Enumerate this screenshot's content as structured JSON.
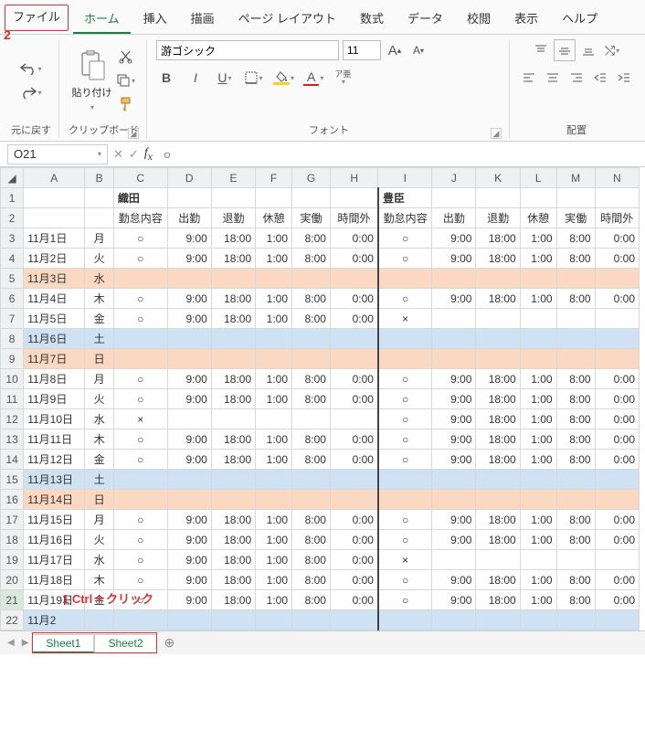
{
  "menu": {
    "items": [
      "ファイル",
      "ホーム",
      "挿入",
      "描画",
      "ページ レイアウト",
      "数式",
      "データ",
      "校閲",
      "表示",
      "ヘルプ"
    ],
    "active": 1,
    "file_highlighted": 0
  },
  "callouts": {
    "file": "2",
    "tabs": "1 Ctrl + クリック"
  },
  "ribbon": {
    "undo": {
      "label": "元に戻す"
    },
    "clipboard": {
      "label": "クリップボード",
      "paste": "貼り付け"
    },
    "font": {
      "label": "フォント",
      "family": "游ゴシック",
      "size": "11",
      "ruby": "ア亜"
    },
    "align": {
      "label": "配置"
    }
  },
  "namebox": "O21",
  "formula": "○",
  "columns": [
    "A",
    "B",
    "C",
    "D",
    "E",
    "F",
    "G",
    "H",
    "I",
    "J",
    "K",
    "L",
    "M",
    "N"
  ],
  "header1": {
    "left_name": "織田",
    "right_name": "豊臣"
  },
  "header2": [
    "勤怠内容",
    "出勤",
    "退勤",
    "休憩",
    "実働",
    "時間外",
    "勤怠内容",
    "出勤",
    "退勤",
    "休憩",
    "実働",
    "時間外"
  ],
  "rows": [
    {
      "n": 3,
      "date": "11月1日",
      "dow": "月",
      "l": [
        "○",
        "9:00",
        "18:00",
        "1:00",
        "8:00",
        "0:00"
      ],
      "r": [
        "○",
        "9:00",
        "18:00",
        "1:00",
        "8:00",
        "0:00"
      ]
    },
    {
      "n": 4,
      "date": "11月2日",
      "dow": "火",
      "l": [
        "○",
        "9:00",
        "18:00",
        "1:00",
        "8:00",
        "0:00"
      ],
      "r": [
        "○",
        "9:00",
        "18:00",
        "1:00",
        "8:00",
        "0:00"
      ]
    },
    {
      "n": 5,
      "date": "11月3日",
      "dow": "水",
      "style": "orange"
    },
    {
      "n": 6,
      "date": "11月4日",
      "dow": "木",
      "l": [
        "○",
        "9:00",
        "18:00",
        "1:00",
        "8:00",
        "0:00"
      ],
      "r": [
        "○",
        "9:00",
        "18:00",
        "1:00",
        "8:00",
        "0:00"
      ]
    },
    {
      "n": 7,
      "date": "11月5日",
      "dow": "金",
      "l": [
        "○",
        "9:00",
        "18:00",
        "1:00",
        "8:00",
        "0:00"
      ],
      "r": [
        "×",
        "",
        "",
        "",
        "",
        ""
      ]
    },
    {
      "n": 8,
      "date": "11月6日",
      "dow": "土",
      "style": "blue"
    },
    {
      "n": 9,
      "date": "11月7日",
      "dow": "日",
      "style": "orange"
    },
    {
      "n": 10,
      "date": "11月8日",
      "dow": "月",
      "l": [
        "○",
        "9:00",
        "18:00",
        "1:00",
        "8:00",
        "0:00"
      ],
      "r": [
        "○",
        "9:00",
        "18:00",
        "1:00",
        "8:00",
        "0:00"
      ]
    },
    {
      "n": 11,
      "date": "11月9日",
      "dow": "火",
      "l": [
        "○",
        "9:00",
        "18:00",
        "1:00",
        "8:00",
        "0:00"
      ],
      "r": [
        "○",
        "9:00",
        "18:00",
        "1:00",
        "8:00",
        "0:00"
      ]
    },
    {
      "n": 12,
      "date": "11月10日",
      "dow": "水",
      "l": [
        "×",
        "",
        "",
        "",
        "",
        ""
      ],
      "r": [
        "○",
        "9:00",
        "18:00",
        "1:00",
        "8:00",
        "0:00"
      ]
    },
    {
      "n": 13,
      "date": "11月11日",
      "dow": "木",
      "l": [
        "○",
        "9:00",
        "18:00",
        "1:00",
        "8:00",
        "0:00"
      ],
      "r": [
        "○",
        "9:00",
        "18:00",
        "1:00",
        "8:00",
        "0:00"
      ]
    },
    {
      "n": 14,
      "date": "11月12日",
      "dow": "金",
      "l": [
        "○",
        "9:00",
        "18:00",
        "1:00",
        "8:00",
        "0:00"
      ],
      "r": [
        "○",
        "9:00",
        "18:00",
        "1:00",
        "8:00",
        "0:00"
      ]
    },
    {
      "n": 15,
      "date": "11月13日",
      "dow": "土",
      "style": "blue"
    },
    {
      "n": 16,
      "date": "11月14日",
      "dow": "日",
      "style": "orange"
    },
    {
      "n": 17,
      "date": "11月15日",
      "dow": "月",
      "l": [
        "○",
        "9:00",
        "18:00",
        "1:00",
        "8:00",
        "0:00"
      ],
      "r": [
        "○",
        "9:00",
        "18:00",
        "1:00",
        "8:00",
        "0:00"
      ]
    },
    {
      "n": 18,
      "date": "11月16日",
      "dow": "火",
      "l": [
        "○",
        "9:00",
        "18:00",
        "1:00",
        "8:00",
        "0:00"
      ],
      "r": [
        "○",
        "9:00",
        "18:00",
        "1:00",
        "8:00",
        "0:00"
      ]
    },
    {
      "n": 19,
      "date": "11月17日",
      "dow": "水",
      "l": [
        "○",
        "9:00",
        "18:00",
        "1:00",
        "8:00",
        "0:00"
      ],
      "r": [
        "×",
        "",
        "",
        "",
        "",
        ""
      ]
    },
    {
      "n": 20,
      "date": "11月18日",
      "dow": "木",
      "l": [
        "○",
        "9:00",
        "18:00",
        "1:00",
        "8:00",
        "0:00"
      ],
      "r": [
        "○",
        "9:00",
        "18:00",
        "1:00",
        "8:00",
        "0:00"
      ]
    },
    {
      "n": 21,
      "date": "11月19日",
      "dow": "金",
      "l": [
        "○",
        "9:00",
        "18:00",
        "1:00",
        "8:00",
        "0:00"
      ],
      "r": [
        "○",
        "9:00",
        "18:00",
        "1:00",
        "8:00",
        "0:00"
      ]
    },
    {
      "n": 22,
      "date": "11月2",
      "dow": "",
      "style": "blue",
      "partial": true
    }
  ],
  "tabs": {
    "sheets": [
      "Sheet1",
      "Sheet2"
    ],
    "active": 0
  }
}
